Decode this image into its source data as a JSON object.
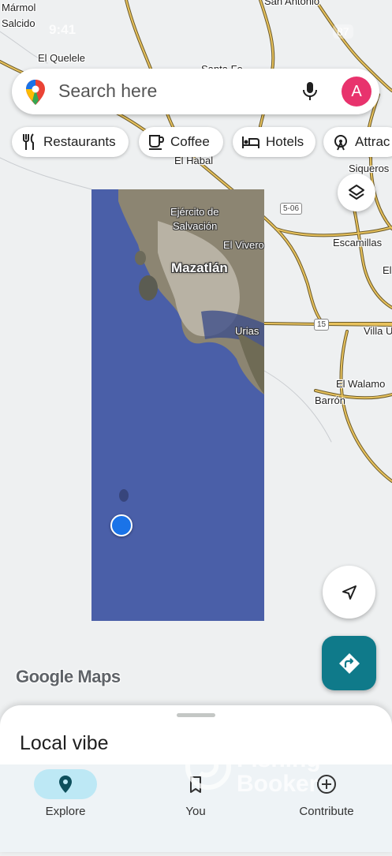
{
  "status_bar": {
    "time": "9:41",
    "battery": "87"
  },
  "map": {
    "labels": [
      {
        "text": "Mármol",
        "kind": "town"
      },
      {
        "text": "Salcido",
        "kind": "town"
      },
      {
        "text": "El Quelele",
        "kind": "town"
      },
      {
        "text": "San Antonio",
        "kind": "town"
      },
      {
        "text": "Santa Fe",
        "kind": "town"
      },
      {
        "text": "El Habal",
        "kind": "town"
      },
      {
        "text": "Siqueros",
        "kind": "town"
      },
      {
        "text": "Ejército de",
        "kind": "sat"
      },
      {
        "text": "Salvación",
        "kind": "sat"
      },
      {
        "text": "El Vivero",
        "kind": "sat"
      },
      {
        "text": "Mazatlán",
        "kind": "city"
      },
      {
        "text": "Escamillas",
        "kind": "town"
      },
      {
        "text": "Urias",
        "kind": "sat"
      },
      {
        "text": "Villa U",
        "kind": "town"
      },
      {
        "text": "El Walamo",
        "kind": "town"
      },
      {
        "text": "Barrón",
        "kind": "town"
      },
      {
        "text": "El",
        "kind": "town"
      }
    ],
    "route_shields": [
      "5-06",
      "15"
    ],
    "logo": "Google Maps"
  },
  "search": {
    "placeholder": "Search here",
    "avatar_letter": "A"
  },
  "chips": [
    {
      "label": "Restaurants",
      "icon": "fork-knife-icon"
    },
    {
      "label": "Coffee",
      "icon": "coffee-cup-icon"
    },
    {
      "label": "Hotels",
      "icon": "bed-icon"
    },
    {
      "label": "Attrac",
      "icon": "ferris-wheel-icon"
    }
  ],
  "sheet": {
    "title": "Local vibe"
  },
  "nav": {
    "items": [
      {
        "label": "Explore",
        "icon": "location-pin-icon",
        "active": true
      },
      {
        "label": "You",
        "icon": "bookmark-icon",
        "active": false
      },
      {
        "label": "Contribute",
        "icon": "add-circle-icon",
        "active": false
      }
    ]
  },
  "watermark": {
    "line1": "Fishing",
    "line2": "Booker"
  },
  "colors": {
    "accent": "#0f7a8a",
    "avatar": "#e8336d",
    "ocean": "#4a5fa8",
    "nav_pill": "#bde8f5"
  }
}
